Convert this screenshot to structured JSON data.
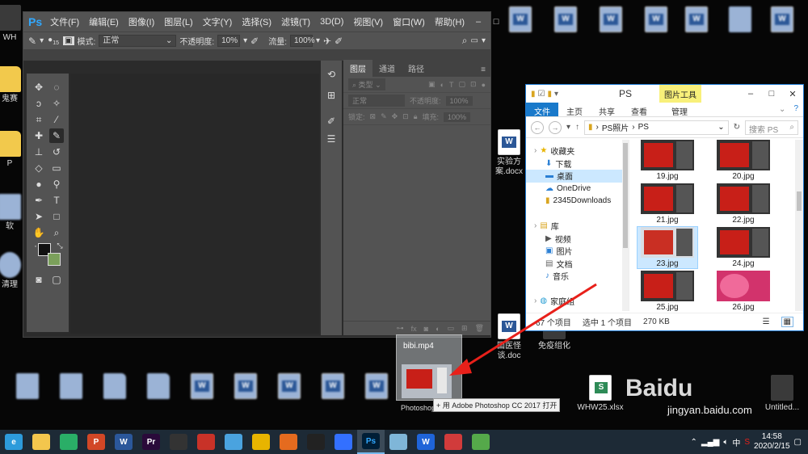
{
  "photoshop": {
    "logo": "Ps",
    "menus": [
      "文件(F)",
      "编辑(E)",
      "图像(I)",
      "图层(L)",
      "文字(Y)",
      "选择(S)",
      "滤镜(T)",
      "3D(D)",
      "视图(V)",
      "窗口(W)",
      "帮助(H)"
    ],
    "options": {
      "brush_size": "15",
      "mode_label": "模式:",
      "mode_value": "正常",
      "opacity_label": "不透明度:",
      "opacity_value": "10%",
      "flow_label": "流量:",
      "flow_value": "100%"
    },
    "layers_panel": {
      "tabs": [
        "图层",
        "通道",
        "路径"
      ],
      "kind_label": "类型",
      "blend_value": "正常",
      "opacity_label": "不透明度:",
      "opacity_value": "100%",
      "lock_label": "锁定:",
      "fill_label": "填充:",
      "fill_value": "100%"
    },
    "colors": {
      "foreground": "#111111",
      "background": "#7ba05b",
      "accent": "#31a8ff"
    }
  },
  "explorer": {
    "title": "PS",
    "tool_tab": "图片工具",
    "ribbon_tabs": [
      "文件",
      "主页",
      "共享",
      "查看",
      "管理"
    ],
    "breadcrumb": [
      "PS照片",
      "PS"
    ],
    "search_placeholder": "搜索 PS",
    "sidebar": [
      {
        "label": "收藏夹",
        "icon": "star-icon",
        "sub": false
      },
      {
        "label": "下载",
        "icon": "download-folder-icon",
        "sub": true
      },
      {
        "label": "桌面",
        "icon": "desktop-folder-icon",
        "sub": true,
        "selected": true
      },
      {
        "label": "OneDrive",
        "icon": "cloud-icon",
        "sub": true
      },
      {
        "label": "2345Downloads",
        "icon": "folder-icon",
        "sub": true
      },
      {
        "label": "",
        "icon": "",
        "sub": false,
        "spacer": true
      },
      {
        "label": "库",
        "icon": "library-icon",
        "sub": false
      },
      {
        "label": "视频",
        "icon": "video-icon",
        "sub": true
      },
      {
        "label": "图片",
        "icon": "picture-icon",
        "sub": true
      },
      {
        "label": "文档",
        "icon": "document-icon",
        "sub": true
      },
      {
        "label": "音乐",
        "icon": "music-icon",
        "sub": true
      },
      {
        "label": "",
        "icon": "",
        "sub": false,
        "spacer": true
      },
      {
        "label": "家庭组",
        "icon": "homegroup-icon",
        "sub": false
      }
    ],
    "files": [
      "19.jpg",
      "20.jpg",
      "21.jpg",
      "22.jpg",
      "23.jpg",
      "24.jpg",
      "25.jpg",
      "26.jpg"
    ],
    "selected_file": "23.jpg",
    "status": {
      "count": "67 个项目",
      "selected": "选中 1 个项目",
      "size": "270 KB"
    }
  },
  "desktop": {
    "icons": [
      {
        "label": "实验方案.docx",
        "type": "doc"
      },
      {
        "label": "国医怪谈.doc",
        "type": "doc"
      },
      {
        "label": "免疫组化",
        "type": "dark"
      },
      {
        "label": "bibi.mp4",
        "type": "dark"
      },
      {
        "label": "WHW25.xlsx",
        "type": "xls"
      },
      {
        "label": "Untitled...",
        "type": "dark"
      }
    ],
    "left_edge_labels": [
      "WH",
      "鬼赛",
      "P",
      "软",
      "清理"
    ]
  },
  "drag": {
    "ghost_label": "bibi.mp4",
    "tooltip": "+ 用 Adobe Photoshop CC 2017 打开",
    "ghost_sub": "Photoshop"
  },
  "watermark": {
    "logo": "Baidu",
    "url": "jingyan.baidu.com"
  },
  "taskbar": {
    "apps": [
      {
        "name": "browser-360",
        "label": "e",
        "color": "#2d9bdb"
      },
      {
        "name": "file-explorer",
        "label": "",
        "color": "#f3c64d"
      },
      {
        "name": "wechat",
        "label": "",
        "color": "#2aae67"
      },
      {
        "name": "powerpoint",
        "label": "P",
        "color": "#d24726"
      },
      {
        "name": "word",
        "label": "W",
        "color": "#2b579a"
      },
      {
        "name": "premiere",
        "label": "Pr",
        "color": "#2a0a3a"
      },
      {
        "name": "video-editor",
        "label": "",
        "color": "#333333"
      },
      {
        "name": "app-red",
        "label": "",
        "color": "#c83228"
      },
      {
        "name": "cloud",
        "label": "",
        "color": "#4aa3df"
      },
      {
        "name": "chrome",
        "label": "",
        "color": "#e8b400"
      },
      {
        "name": "app-orange",
        "label": "",
        "color": "#e56b1f"
      },
      {
        "name": "qq",
        "label": "",
        "color": "#222222"
      },
      {
        "name": "feishu",
        "label": "",
        "color": "#3370ff"
      },
      {
        "name": "photoshop",
        "label": "Ps",
        "color": "#001e36",
        "active": true
      },
      {
        "name": "app-tilted",
        "label": "",
        "color": "#7fb6d8"
      },
      {
        "name": "wps",
        "label": "W",
        "color": "#1f64d8"
      },
      {
        "name": "app-flower",
        "label": "",
        "color": "#d13b3b"
      },
      {
        "name": "app-green",
        "label": "",
        "color": "#55a94a"
      }
    ],
    "tray_label": "中",
    "time": "14:58",
    "date": "2020/2/15"
  }
}
